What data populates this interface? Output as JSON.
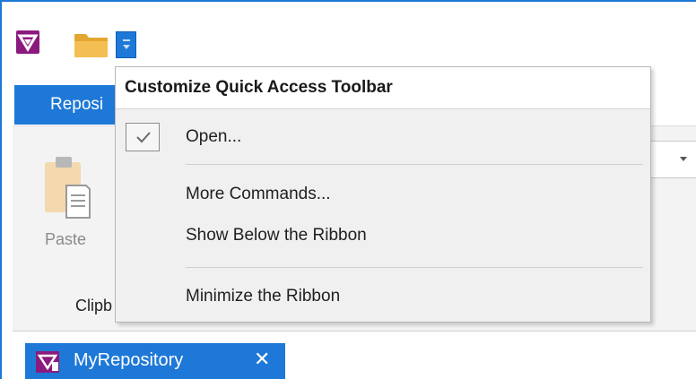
{
  "quick_access": {
    "app_icon": "app-logo-icon",
    "folder_icon": "folder-icon",
    "dropdown_icon": "customize-dropdown-icon"
  },
  "ribbon": {
    "active_tab_label": "Reposi",
    "paste_label": "Paste",
    "group_label": "Clipb",
    "combo_arrow": "chevron-down-icon"
  },
  "menu": {
    "title": "Customize Quick Access Toolbar",
    "items": [
      {
        "label": "Open...",
        "checked": true
      },
      {
        "label": "More Commands..."
      },
      {
        "label": "Show Below the Ribbon"
      },
      {
        "label": "Minimize the Ribbon"
      }
    ]
  },
  "document_tab": {
    "label": "MyRepository",
    "close_glyph": "✕"
  },
  "colors": {
    "accent": "#1e78d7",
    "brand": "#8b1a7e",
    "menu_bg": "#f0f0f0"
  }
}
